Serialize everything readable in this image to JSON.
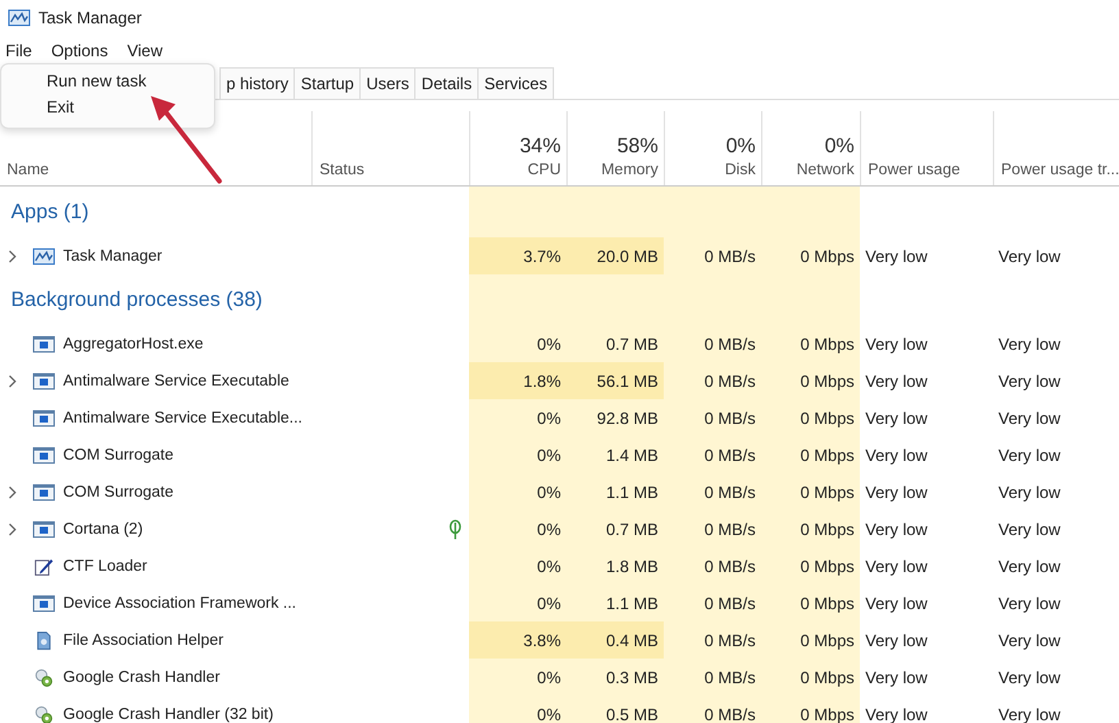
{
  "window": {
    "title": "Task Manager"
  },
  "menu_bar": [
    "File",
    "Options",
    "View"
  ],
  "tabs": [
    {
      "label": "p history",
      "selected": false
    },
    {
      "label": "Startup",
      "selected": false
    },
    {
      "label": "Users",
      "selected": false
    },
    {
      "label": "Details",
      "selected": false
    },
    {
      "label": "Services",
      "selected": false
    }
  ],
  "file_menu": [
    "Run new task",
    "Exit"
  ],
  "columns": [
    {
      "label": "Name"
    },
    {
      "label": "Status"
    },
    {
      "label": "CPU",
      "total": "34%"
    },
    {
      "label": "Memory",
      "total": "58%"
    },
    {
      "label": "Disk",
      "total": "0%"
    },
    {
      "label": "Network",
      "total": "0%"
    },
    {
      "label": "Power usage"
    },
    {
      "label": "Power usage tr..."
    }
  ],
  "groups": [
    {
      "title": "Apps (1)",
      "rows": [
        {
          "name": "Task Manager",
          "kind": "chart",
          "expandable": true,
          "suspended": false,
          "hot": true,
          "cpu": "3.7%",
          "memory": "20.0 MB",
          "disk": "0 MB/s",
          "network": "0 Mbps",
          "power": "Very low",
          "power_trend": "Very low"
        }
      ]
    },
    {
      "title": "Background processes (38)",
      "rows": [
        {
          "name": "AggregatorHost.exe",
          "kind": "window",
          "expandable": false,
          "suspended": false,
          "hot": false,
          "cpu": "0%",
          "memory": "0.7 MB",
          "disk": "0 MB/s",
          "network": "0 Mbps",
          "power": "Very low",
          "power_trend": "Very low"
        },
        {
          "name": "Antimalware Service Executable",
          "kind": "window",
          "expandable": true,
          "suspended": false,
          "hot": true,
          "cpu": "1.8%",
          "memory": "56.1 MB",
          "disk": "0 MB/s",
          "network": "0 Mbps",
          "power": "Very low",
          "power_trend": "Very low"
        },
        {
          "name": "Antimalware Service Executable...",
          "kind": "window",
          "expandable": false,
          "suspended": false,
          "hot": false,
          "cpu": "0%",
          "memory": "92.8 MB",
          "disk": "0 MB/s",
          "network": "0 Mbps",
          "power": "Very low",
          "power_trend": "Very low"
        },
        {
          "name": "COM Surrogate",
          "kind": "window",
          "expandable": false,
          "suspended": false,
          "hot": false,
          "cpu": "0%",
          "memory": "1.4 MB",
          "disk": "0 MB/s",
          "network": "0 Mbps",
          "power": "Very low",
          "power_trend": "Very low"
        },
        {
          "name": "COM Surrogate",
          "kind": "window",
          "expandable": true,
          "suspended": false,
          "hot": false,
          "cpu": "0%",
          "memory": "1.1 MB",
          "disk": "0 MB/s",
          "network": "0 Mbps",
          "power": "Very low",
          "power_trend": "Very low"
        },
        {
          "name": "Cortana (2)",
          "kind": "window",
          "expandable": true,
          "suspended": true,
          "hot": false,
          "cpu": "0%",
          "memory": "0.7 MB",
          "disk": "0 MB/s",
          "network": "0 Mbps",
          "power": "Very low",
          "power_trend": "Very low"
        },
        {
          "name": "CTF Loader",
          "kind": "pen",
          "expandable": false,
          "suspended": false,
          "hot": false,
          "cpu": "0%",
          "memory": "1.8 MB",
          "disk": "0 MB/s",
          "network": "0 Mbps",
          "power": "Very low",
          "power_trend": "Very low"
        },
        {
          "name": "Device Association Framework ...",
          "kind": "window",
          "expandable": false,
          "suspended": false,
          "hot": false,
          "cpu": "0%",
          "memory": "1.1 MB",
          "disk": "0 MB/s",
          "network": "0 Mbps",
          "power": "Very low",
          "power_trend": "Very low"
        },
        {
          "name": "File Association Helper",
          "kind": "file",
          "expandable": false,
          "suspended": false,
          "hot": true,
          "cpu": "3.8%",
          "memory": "0.4 MB",
          "disk": "0 MB/s",
          "network": "0 Mbps",
          "power": "Very low",
          "power_trend": "Very low"
        },
        {
          "name": "Google Crash Handler",
          "kind": "crash",
          "expandable": false,
          "suspended": false,
          "hot": false,
          "cpu": "0%",
          "memory": "0.3 MB",
          "disk": "0 MB/s",
          "network": "0 Mbps",
          "power": "Very low",
          "power_trend": "Very low"
        },
        {
          "name": "Google Crash Handler (32 bit)",
          "kind": "crash",
          "expandable": false,
          "suspended": false,
          "hot": false,
          "cpu": "0%",
          "memory": "0.5 MB",
          "disk": "0 MB/s",
          "network": "0 Mbps",
          "power": "Very low",
          "power_trend": "Very low"
        }
      ]
    }
  ]
}
